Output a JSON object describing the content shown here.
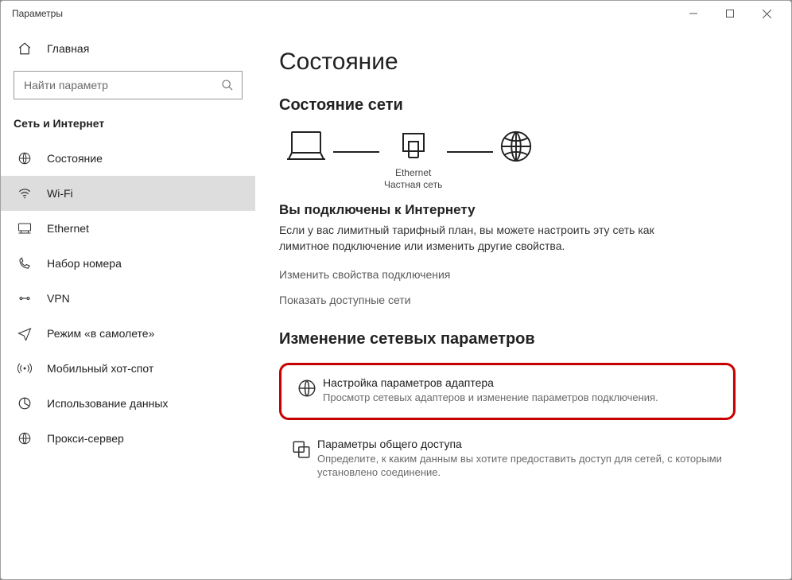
{
  "window": {
    "title": "Параметры"
  },
  "sidebar": {
    "home": "Главная",
    "search_placeholder": "Найти параметр",
    "section": "Сеть и Интернет",
    "items": [
      {
        "id": "status",
        "label": "Состояние"
      },
      {
        "id": "wifi",
        "label": "Wi-Fi"
      },
      {
        "id": "ethernet",
        "label": "Ethernet"
      },
      {
        "id": "dialup",
        "label": "Набор номера"
      },
      {
        "id": "vpn",
        "label": "VPN"
      },
      {
        "id": "airplane",
        "label": "Режим «в самолете»"
      },
      {
        "id": "hotspot",
        "label": "Мобильный хот-спот"
      },
      {
        "id": "datausage",
        "label": "Использование данных"
      },
      {
        "id": "proxy",
        "label": "Прокси-сервер"
      }
    ]
  },
  "main": {
    "title": "Состояние",
    "net_status_heading": "Состояние сети",
    "diagram": {
      "middle_label": "Ethernet",
      "middle_sub": "Частная сеть"
    },
    "connected_heading": "Вы подключены к Интернету",
    "connected_desc": "Если у вас лимитный тарифный план, вы можете настроить эту сеть как лимитное подключение или изменить другие свойства.",
    "link_change_props": "Изменить свойства подключения",
    "link_show_networks": "Показать доступные сети",
    "change_params_heading": "Изменение сетевых параметров",
    "adapter": {
      "title": "Настройка параметров адаптера",
      "desc": "Просмотр сетевых адаптеров и изменение параметров подключения."
    },
    "sharing": {
      "title": "Параметры общего доступа",
      "desc": "Определите, к каким данным вы хотите предоставить доступ для сетей, с которыми установлено соединение."
    }
  }
}
